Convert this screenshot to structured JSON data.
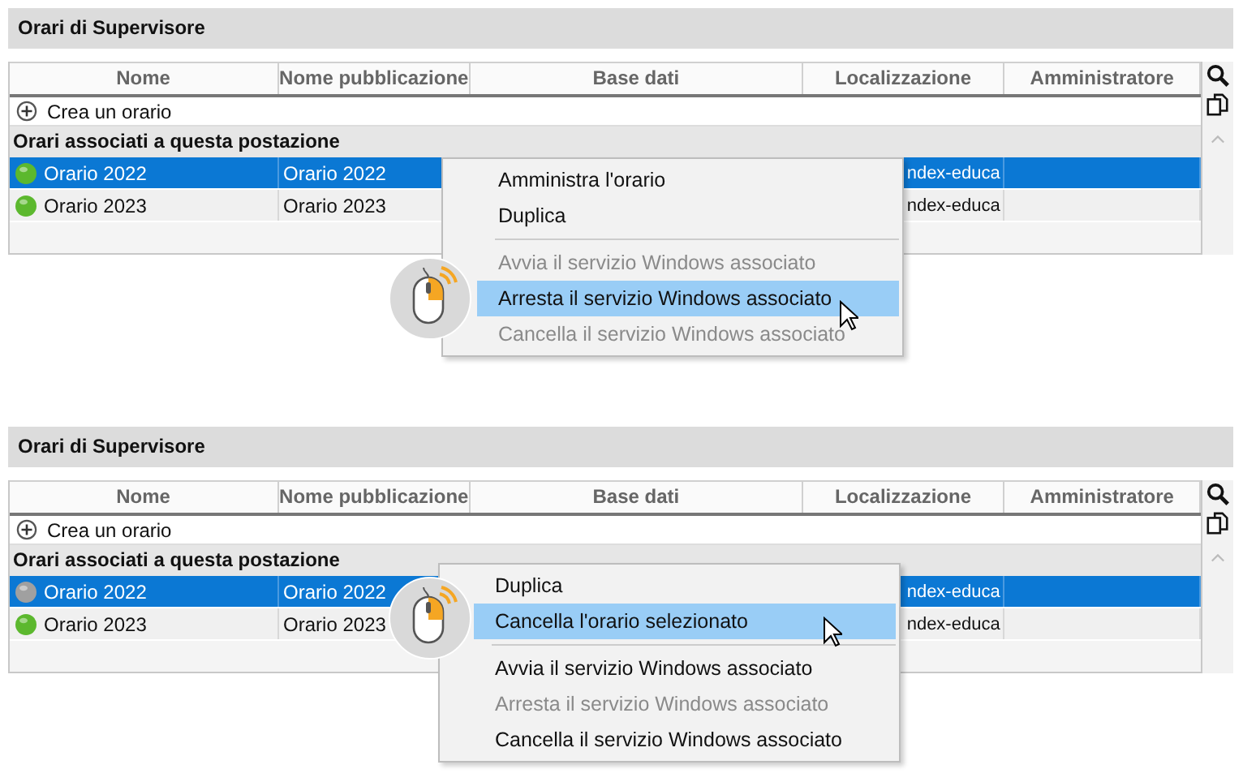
{
  "panels": [
    {
      "title": "Orari di Supervisore",
      "columns": [
        "Nome",
        "Nome pubblicazione",
        "Base dati",
        "Localizzazione",
        "Amministratore"
      ],
      "create_label": "Crea un orario",
      "group_label": "Orari associati a questa postazione",
      "rows": [
        {
          "name": "Orario 2022",
          "color": "#5cb82e",
          "publication": "Orario 2022",
          "location": "ndex-educa",
          "selected": true
        },
        {
          "name": "Orario 2023",
          "color": "#5cb82e",
          "publication": "Orario 2023",
          "location": "ndex-educa",
          "selected": false
        }
      ],
      "menu": [
        {
          "kind": "item",
          "label": "Amministra l'orario",
          "disabled": false,
          "highlighted": false
        },
        {
          "kind": "item",
          "label": "Duplica",
          "disabled": false,
          "highlighted": false
        },
        {
          "kind": "separator"
        },
        {
          "kind": "item",
          "label": "Avvia il servizio Windows associato",
          "disabled": true,
          "highlighted": false
        },
        {
          "kind": "item",
          "label": "Arresta il servizio Windows associato",
          "disabled": false,
          "highlighted": true
        },
        {
          "kind": "item",
          "label": "Cancella il servizio Windows associato",
          "disabled": true,
          "highlighted": false
        }
      ]
    },
    {
      "title": "Orari di Supervisore",
      "columns": [
        "Nome",
        "Nome pubblicazione",
        "Base dati",
        "Localizzazione",
        "Amministratore"
      ],
      "create_label": "Crea un orario",
      "group_label": "Orari associati a questa postazione",
      "rows": [
        {
          "name": "Orario 2022",
          "color": "#a0a0a0",
          "publication": "Orario 2022",
          "location": "ndex-educa",
          "selected": true
        },
        {
          "name": "Orario 2023",
          "color": "#5cb82e",
          "publication": "Orario 2023",
          "location": "ndex-educa",
          "selected": false
        }
      ],
      "menu": [
        {
          "kind": "item",
          "label": "Duplica",
          "disabled": false,
          "highlighted": false
        },
        {
          "kind": "item",
          "label": "Cancella l'orario selezionato",
          "disabled": false,
          "highlighted": true
        },
        {
          "kind": "separator"
        },
        {
          "kind": "item",
          "label": "Avvia il servizio Windows associato",
          "disabled": false,
          "highlighted": false
        },
        {
          "kind": "item",
          "label": "Arresta il servizio Windows associato",
          "disabled": true,
          "highlighted": false
        },
        {
          "kind": "item",
          "label": "Cancella il servizio Windows associato",
          "disabled": false,
          "highlighted": false
        }
      ]
    }
  ]
}
